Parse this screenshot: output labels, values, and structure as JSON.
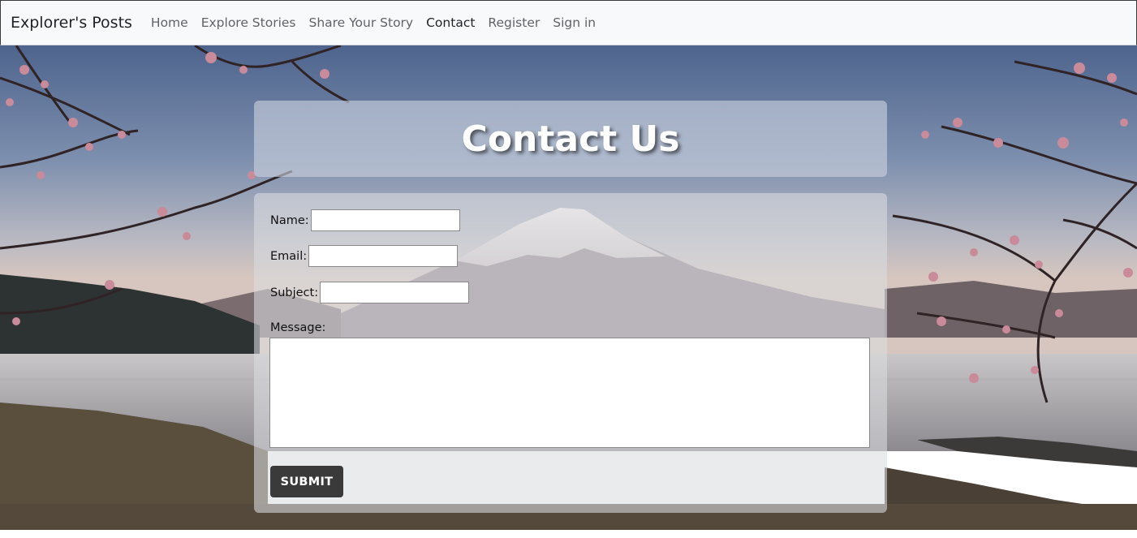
{
  "navbar": {
    "brand": "Explorer's Posts",
    "links": [
      "Home",
      "Explore Stories",
      "Share Your Story",
      "Contact",
      "Register",
      "Sign in"
    ],
    "active": "Contact"
  },
  "page": {
    "title": "Contact Us"
  },
  "form": {
    "name_label": "Name:",
    "name_value": "",
    "email_label": "Email:",
    "email_value": "",
    "subject_label": "Subject:",
    "subject_value": "",
    "message_label": "Message:",
    "message_value": "",
    "submit_label": "SUBMIT"
  },
  "colors": {
    "navbar_bg": "#f8f9fa",
    "button_bg": "#3a3a3a",
    "title_text": "#ffffff"
  }
}
